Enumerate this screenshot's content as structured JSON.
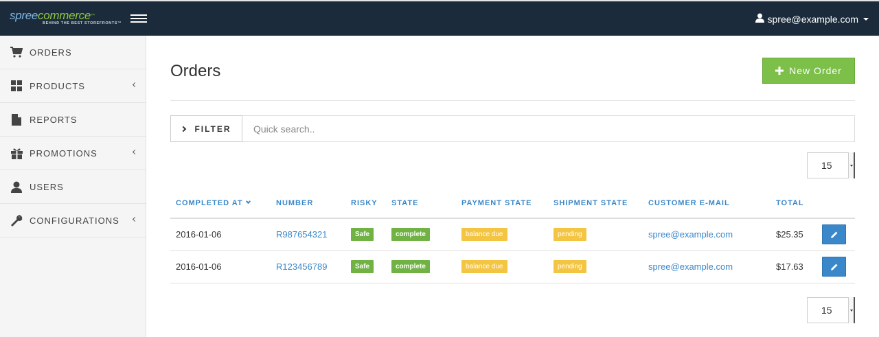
{
  "brand": {
    "name_part1": "spree",
    "name_part2": "commerce",
    "trademark": "™",
    "tagline": "BEHIND THE BEST STOREFRONTS™"
  },
  "header": {
    "user_email": "spree@example.com"
  },
  "sidebar": {
    "items": [
      {
        "label": "ORDERS",
        "icon": "cart-icon",
        "expandable": false
      },
      {
        "label": "PRODUCTS",
        "icon": "grid-icon",
        "expandable": true
      },
      {
        "label": "REPORTS",
        "icon": "file-icon",
        "expandable": false
      },
      {
        "label": "PROMOTIONS",
        "icon": "gift-icon",
        "expandable": true
      },
      {
        "label": "USERS",
        "icon": "user-icon",
        "expandable": false
      },
      {
        "label": "CONFIGURATIONS",
        "icon": "wrench-icon",
        "expandable": true
      }
    ]
  },
  "page": {
    "title": "Orders",
    "new_order_label": "New Order"
  },
  "filter": {
    "button_label": "FILTER",
    "search_placeholder": "Quick search.."
  },
  "pagination": {
    "per_page_top": "15",
    "per_page_bottom": "15"
  },
  "table": {
    "columns": [
      "COMPLETED AT",
      "NUMBER",
      "RISKY",
      "STATE",
      "PAYMENT STATE",
      "SHIPMENT STATE",
      "CUSTOMER E-MAIL",
      "TOTAL"
    ],
    "rows": [
      {
        "completed_at": "2016-01-06",
        "number": "R987654321",
        "risky": "Safe",
        "state": "complete",
        "payment_state": "balance due",
        "shipment_state": "pending",
        "email": "spree@example.com",
        "total": "$25.35"
      },
      {
        "completed_at": "2016-01-06",
        "number": "R123456789",
        "risky": "Safe",
        "state": "complete",
        "payment_state": "balance due",
        "shipment_state": "pending",
        "email": "spree@example.com",
        "total": "$17.63"
      }
    ]
  },
  "colors": {
    "topbar": "#1b2b3b",
    "accent_blue": "#3a87c9",
    "success_green": "#7cbf49",
    "warning_yellow": "#f4c542"
  }
}
